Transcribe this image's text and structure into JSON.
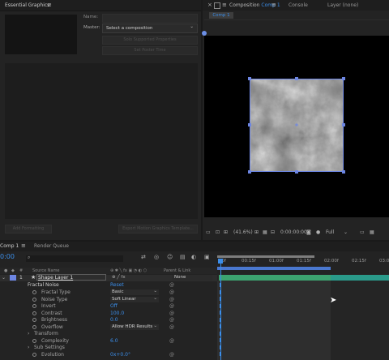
{
  "essential_graphics": {
    "title": "Essential Graphics",
    "menu_icon": "hamburger-icon",
    "name_label": "Name:",
    "name_value": "",
    "master_label": "Master:",
    "master_value": "Select a composition",
    "solo_button": "Solo Supported Properties",
    "poster_button": "Set Poster Time",
    "add_formatting_button": "Add Formatting",
    "export_button": "Export Motion Graphics Template..."
  },
  "composition_panel": {
    "tab_prefix": "Composition",
    "tab_comp": "Comp 1",
    "console_tab": "Console",
    "layer_tab": "Layer (none)",
    "breadcrumb": "Comp 1",
    "zoom": "(41.6%)",
    "timecode": "0:00:00:00",
    "resolution": "Full"
  },
  "timeline_panel": {
    "tab_comp": "Comp 1",
    "render_queue_tab": "Render Queue",
    "current_time": "0:00",
    "search_placeholder": "",
    "col_source_name": "Source Name",
    "col_parent_link": "Parent & Link",
    "ruler_ticks": [
      "00f",
      "00:15f",
      "01:00f",
      "01:15f",
      "02:00f",
      "02:15f",
      "03:0"
    ],
    "layer": {
      "number": "1",
      "name": "Shape Layer 1",
      "parent": "None"
    },
    "effect_name": "Fractal Noise",
    "effect_reset": "Reset",
    "properties": [
      {
        "name": "Fractal Type",
        "value": "Basic",
        "type": "select"
      },
      {
        "name": "Noise Type",
        "value": "Soft Linear",
        "type": "select"
      },
      {
        "name": "Invert",
        "value": "Off",
        "type": "value"
      },
      {
        "name": "Contrast",
        "value": "100.0",
        "type": "value"
      },
      {
        "name": "Brightness",
        "value": "0.0",
        "type": "value"
      },
      {
        "name": "Overflow",
        "value": "Allow HDR Results",
        "type": "select"
      },
      {
        "name": "Transform",
        "value": "",
        "type": "group"
      },
      {
        "name": "Complexity",
        "value": "6.0",
        "type": "value"
      },
      {
        "name": "Sub Settings",
        "value": "",
        "type": "group"
      },
      {
        "name": "Evolution",
        "value": "0x+0.0°",
        "type": "value"
      }
    ]
  },
  "colors": {
    "accent_blue": "#3b8eea",
    "layer_label": "#6d86e3",
    "layer_bar": "#2a9a8a"
  }
}
